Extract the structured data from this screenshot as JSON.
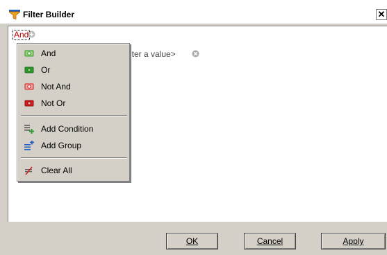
{
  "window": {
    "title": "Filter Builder"
  },
  "editor": {
    "root_operator": "And",
    "condition_placeholder": "nter a value>"
  },
  "menu": {
    "groups": [
      "And",
      "Or",
      "Not And",
      "Not Or"
    ],
    "actions": [
      "Add Condition",
      "Add Group"
    ],
    "clear": "Clear All"
  },
  "buttons": {
    "ok": "OK",
    "cancel": "Cancel",
    "apply": "Apply"
  },
  "colors": {
    "operator": "#c00000",
    "group_green": "#2a9d2a",
    "group_red": "#d02020"
  },
  "icons": {
    "and": "group-and-icon",
    "or": "group-or-icon",
    "not_and": "group-not-and-icon",
    "not_or": "group-not-or-icon",
    "add_condition": "add-condition-icon",
    "add_group": "add-group-icon",
    "clear_all": "clear-all-icon"
  }
}
